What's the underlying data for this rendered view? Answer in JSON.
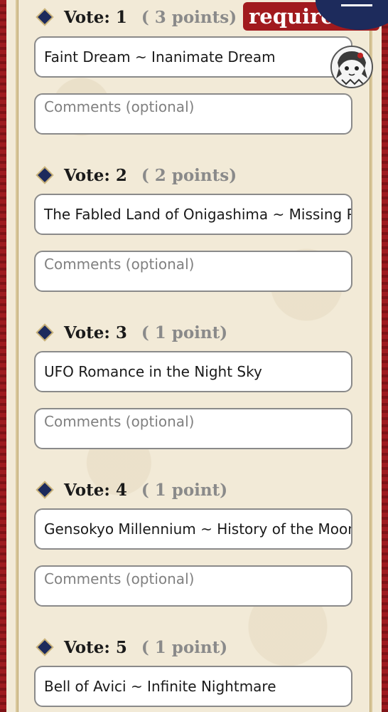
{
  "header": {
    "required_label": "required"
  },
  "comment_placeholder": "Comments (optional)",
  "votes": [
    {
      "label": "Vote: 1",
      "points": "( 3 points)",
      "song": "Faint Dream ~ Inanimate Dream"
    },
    {
      "label": "Vote: 2",
      "points": "( 2 points)",
      "song": "The Fabled Land of Onigashima ~ Missing Power"
    },
    {
      "label": "Vote: 3",
      "points": "( 1 point)",
      "song": "UFO Romance in the Night Sky"
    },
    {
      "label": "Vote: 4",
      "points": "( 1 point)",
      "song": "Gensokyo Millennium ~ History of the Moon"
    },
    {
      "label": "Vote: 5",
      "points": "( 1 point)",
      "song": "Bell of Avici ~ Infinite Nightmare"
    }
  ],
  "colors": {
    "frame_red": "#9a1a1e",
    "panel_cream": "#f2ead7",
    "diamond_navy": "#1c2a5c",
    "points_gray": "#8a8a8a",
    "menu_navy": "#1d2b5c"
  },
  "icons": {
    "bullet": "diamond-icon",
    "menu": "hamburger-menu-icon",
    "avatar": "character-avatar"
  }
}
